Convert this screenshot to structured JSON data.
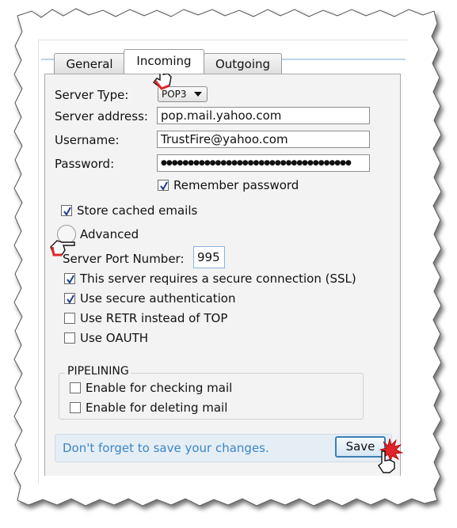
{
  "tabs": [
    {
      "label": "General",
      "active": false
    },
    {
      "label": "Incoming",
      "active": true
    },
    {
      "label": "Outgoing",
      "active": false
    }
  ],
  "server_type": {
    "label": "Server Type:",
    "value": "POP3"
  },
  "server_address": {
    "label": "Server address:",
    "value": "pop.mail.yahoo.com"
  },
  "username": {
    "label": "Username:",
    "value": "TrustFire@yahoo.com"
  },
  "password": {
    "label": "Password:",
    "value": "●●●●●●●●●●●●●●●●●●●●●●●●●●●●●●●●●●●"
  },
  "remember_password": {
    "label": "Remember password",
    "checked": true
  },
  "store_cached": {
    "label": "Store cached emails",
    "checked": true
  },
  "advanced": {
    "label": "Advanced"
  },
  "server_port": {
    "label": "Server Port Number:",
    "value": "995"
  },
  "options": [
    {
      "label": "This server requires a secure connection (SSL)",
      "checked": true
    },
    {
      "label": "Use secure authentication",
      "checked": true
    },
    {
      "label": "Use RETR instead of TOP",
      "checked": false
    },
    {
      "label": "Use OAUTH",
      "checked": false
    }
  ],
  "pipelining": {
    "title": "PIPELINING",
    "items": [
      {
        "label": "Enable for checking mail",
        "checked": false
      },
      {
        "label": "Enable for deleting mail",
        "checked": false
      }
    ]
  },
  "footer": {
    "note": "Don't forget to save your changes.",
    "save_label": "Save"
  },
  "colors": {
    "accent": "#3a86c8",
    "panel": "#f3f3f3",
    "tab_line": "#bcd3ea"
  },
  "icons": [
    "hand-pointer-icon",
    "click-burst-icon",
    "checkmark-icon",
    "dropdown-arrow-icon"
  ]
}
